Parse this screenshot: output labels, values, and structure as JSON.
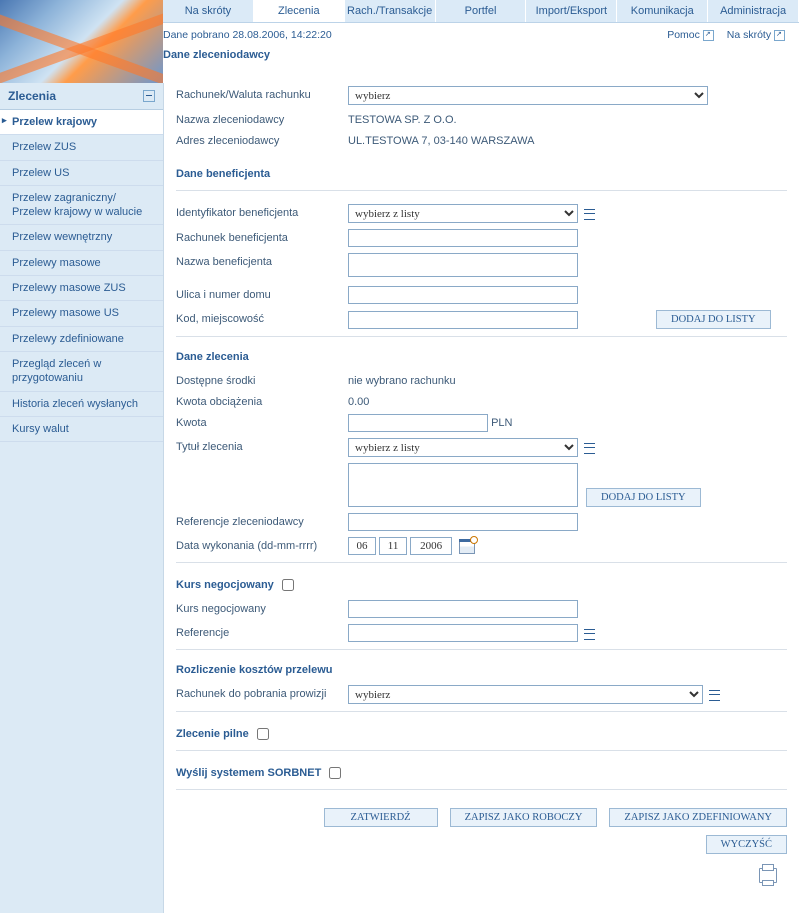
{
  "tabs": [
    "Na skróty",
    "Zlecenia",
    "Rach./Transakcje",
    "Portfel",
    "Import/Eksport",
    "Komunikacja",
    "Administracja"
  ],
  "active_tab_index": 1,
  "timestamp_line": "Dane pobrano 28.08.2006, 14:22:20",
  "header_links": {
    "help": "Pomoc",
    "shortcuts": "Na skróty"
  },
  "sidebar": {
    "title": "Zlecenia",
    "items": [
      "Przelew krajowy",
      "Przelew ZUS",
      "Przelew US",
      "Przelew zagraniczny/ Przelew krajowy w walucie",
      "Przelew wewnętrzny",
      "Przelewy masowe",
      "Przelewy masowe ZUS",
      "Przelewy masowe US",
      "Przelewy zdefiniowane",
      "Przegląd zleceń w przygotowaniu",
      "Historia zleceń wysłanych",
      "Kursy walut"
    ],
    "active_index": 0
  },
  "sections": {
    "payer": {
      "title": "Dane zleceniodawcy",
      "account_label": "Rachunek/Waluta rachunku",
      "account_select": "wybierz",
      "name_label": "Nazwa zleceniodawcy",
      "name_value": "TESTOWA SP. Z O.O.",
      "address_label": "Adres zleceniodawcy",
      "address_value": "UL.TESTOWA 7, 03-140 WARSZAWA"
    },
    "beneficiary": {
      "title": "Dane beneficjenta",
      "id_label": "Identyfikator beneficjenta",
      "id_select": "wybierz z listy",
      "account_label": "Rachunek beneficjenta",
      "name_label": "Nazwa beneficjenta",
      "street_label": "Ulica i numer domu",
      "city_label": "Kod, miejscowość",
      "add_btn": "DODAJ DO LISTY"
    },
    "order": {
      "title": "Dane zlecenia",
      "avail_label": "Dostępne środki",
      "avail_value": "nie wybrano rachunku",
      "debit_label": "Kwota obciążenia",
      "debit_value": "0.00",
      "amount_label": "Kwota",
      "currency": "PLN",
      "title_label": "Tytuł zlecenia",
      "title_select": "wybierz z listy",
      "add_btn": "DODAJ DO LISTY",
      "ref_label": "Referencje zleceniodawcy",
      "date_label": "Data wykonania (dd-mm-rrrr)",
      "date": {
        "d": "06",
        "m": "11",
        "y": "2006"
      }
    },
    "rate": {
      "title": "Kurs negocjowany",
      "rate_label": "Kurs negocjowany",
      "ref_label": "Referencje"
    },
    "costs": {
      "title": "Rozliczenie kosztów przelewu",
      "account_label": "Rachunek do pobrania prowizji",
      "account_select": "wybierz"
    },
    "urgent": {
      "title": "Zlecenie pilne"
    },
    "sorbnet": {
      "title": "Wyślij systemem SORBNET"
    }
  },
  "buttons": {
    "confirm": "ZATWIERDŹ",
    "save_draft": "ZAPISZ JAKO ROBOCZY",
    "save_defined": "ZAPISZ JAKO ZDEFINIOWANY",
    "clear": "WYCZYŚĆ"
  }
}
